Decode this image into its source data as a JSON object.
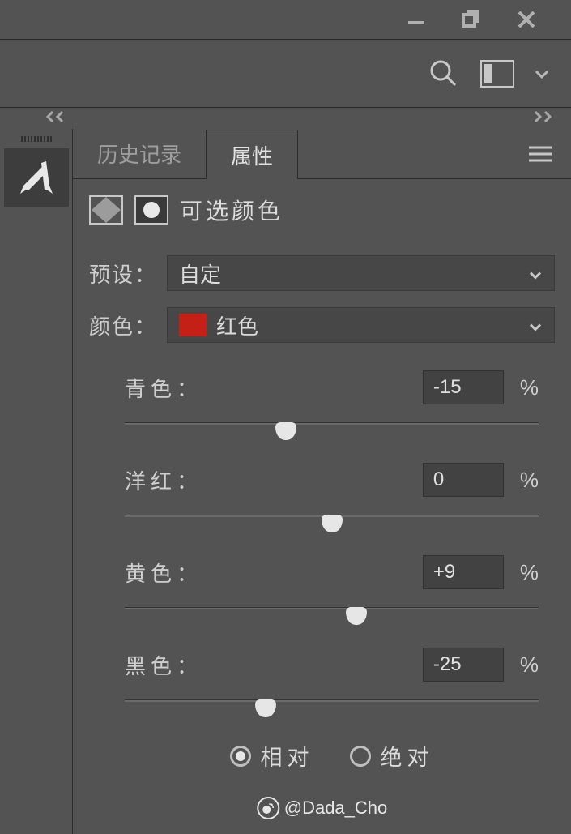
{
  "tabs": {
    "history_label": "历史记录",
    "properties_label": "属性"
  },
  "panel": {
    "title": "可选颜色"
  },
  "preset": {
    "label": "预设：",
    "value": "自定"
  },
  "color": {
    "label": "颜色：",
    "value": "红色",
    "swatch_hex": "#c52015"
  },
  "sliders": [
    {
      "label": "青色：",
      "value": "-15",
      "pct": "%",
      "pos": 39
    },
    {
      "label": "洋红：",
      "value": "0",
      "pct": "%",
      "pos": 50
    },
    {
      "label": "黄色：",
      "value": "+9",
      "pct": "%",
      "pos": 56
    },
    {
      "label": "黑色：",
      "value": "-25",
      "pct": "%",
      "pos": 34
    }
  ],
  "mode": {
    "relative_label": "相对",
    "absolute_label": "绝对",
    "selected": "relative"
  },
  "watermark": "@Dada_Cho"
}
